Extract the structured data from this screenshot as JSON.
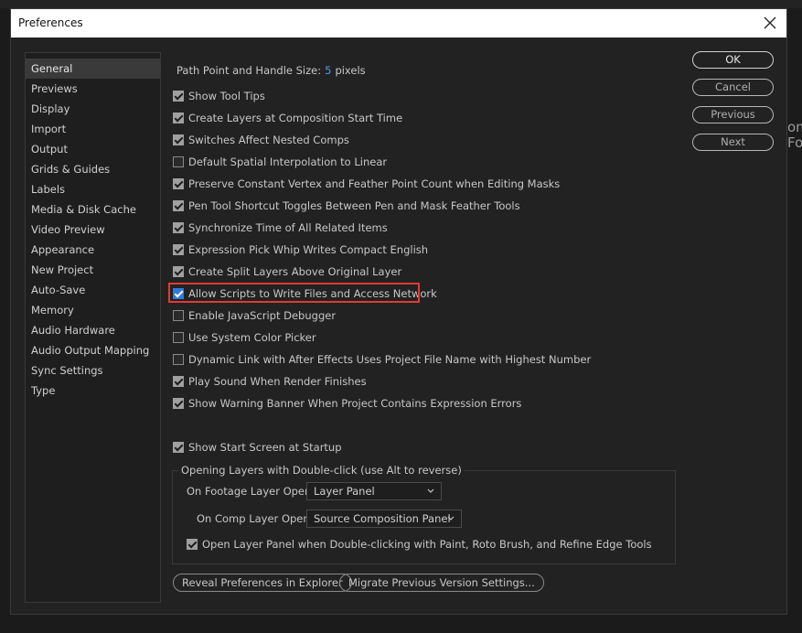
{
  "window": {
    "title": "Preferences"
  },
  "background": {
    "partial_text_1": "om",
    "partial_text_2": "Fo"
  },
  "sidebar": {
    "items": [
      {
        "label": "General",
        "selected": true
      },
      {
        "label": "Previews"
      },
      {
        "label": "Display"
      },
      {
        "label": "Import"
      },
      {
        "label": "Output"
      },
      {
        "label": "Grids & Guides"
      },
      {
        "label": "Labels"
      },
      {
        "label": "Media & Disk Cache"
      },
      {
        "label": "Video Preview"
      },
      {
        "label": "Appearance"
      },
      {
        "label": "New Project"
      },
      {
        "label": "Auto-Save"
      },
      {
        "label": "Memory"
      },
      {
        "label": "Audio Hardware"
      },
      {
        "label": "Audio Output Mapping"
      },
      {
        "label": "Sync Settings"
      },
      {
        "label": "Type"
      }
    ]
  },
  "general": {
    "path_point_label": "Path Point and Handle Size:",
    "path_point_value": "5",
    "path_point_unit": "pixels",
    "checkboxes": [
      {
        "label": "Show Tool Tips",
        "checked": true
      },
      {
        "label": "Create Layers at Composition Start Time",
        "checked": true
      },
      {
        "label": "Switches Affect Nested Comps",
        "checked": true
      },
      {
        "label": "Default Spatial Interpolation to Linear",
        "checked": false
      },
      {
        "label": "Preserve Constant Vertex and Feather Point Count when Editing Masks",
        "checked": true
      },
      {
        "label": "Pen Tool Shortcut Toggles Between Pen and Mask Feather Tools",
        "checked": true
      },
      {
        "label": "Synchronize Time of All Related Items",
        "checked": true
      },
      {
        "label": "Expression Pick Whip Writes Compact English",
        "checked": true
      },
      {
        "label": "Create Split Layers Above Original Layer",
        "checked": true
      },
      {
        "label": "Allow Scripts to Write Files and Access Network",
        "checked": true,
        "highlighted": true
      },
      {
        "label": "Enable JavaScript Debugger",
        "checked": false
      },
      {
        "label": "Use System Color Picker",
        "checked": false
      },
      {
        "label": "Dynamic Link with After Effects Uses Project File Name with Highest Number",
        "checked": false
      },
      {
        "label": "Play Sound When Render Finishes",
        "checked": true
      },
      {
        "label": "Show Warning Banner When Project Contains Expression Errors",
        "checked": true
      }
    ],
    "show_start_screen": {
      "label": "Show Start Screen at Startup",
      "checked": true
    },
    "opening_layers": {
      "title": "Opening Layers with Double-click (use Alt to reverse)",
      "footage_label": "On Footage Layer Opens:",
      "footage_value": "Layer Panel",
      "comp_label": "On Comp Layer Opens:",
      "comp_value": "Source Composition Panel",
      "open_layer_panel": {
        "label": "Open Layer Panel when Double-clicking with Paint, Roto Brush, and Refine Edge Tools",
        "checked": true
      }
    },
    "reveal_button": "Reveal Preferences in Explorer",
    "migrate_button": "Migrate Previous Version Settings..."
  },
  "buttons": {
    "ok": "OK",
    "cancel": "Cancel",
    "previous": "Previous",
    "next": "Next"
  },
  "colors": {
    "accent": "#2d7be0",
    "highlight_border": "#e53935",
    "value_blue": "#4a9de8"
  }
}
